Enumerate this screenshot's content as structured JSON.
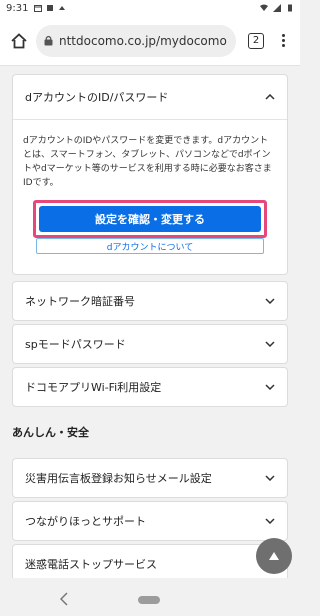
{
  "status_bar": {
    "time": "9:31",
    "icons": [
      "calendar-icon",
      "kanji-notification-icon",
      "cloud-icon",
      "wifi-icon",
      "signal-icon",
      "battery-icon"
    ]
  },
  "browser": {
    "url": "nttdocomo.co.jp/mydocomo",
    "tab_count": "2"
  },
  "accordion_open": {
    "title": "dアカウントのID/パスワード",
    "description": "dアカウントのIDやパスワードを変更できます。dアカウントとは、スマートフォン、タブレット、パソコンなどでdポイントやdマーケット等のサービスを利用する時に必要なお客さまIDです。",
    "primary_button": "設定を確認・変更する",
    "secondary_button": "dアカウントについて"
  },
  "accordion_items": [
    {
      "label": "ネットワーク暗証番号"
    },
    {
      "label": "spモードパスワード"
    },
    {
      "label": "ドコモアプリWi-Fi利用設定"
    }
  ],
  "section": {
    "title": "あんしん・安全"
  },
  "safety_items": [
    {
      "label": "災害用伝言板登録お知らせメール設定"
    },
    {
      "label": "つながりほっとサポート"
    },
    {
      "label": "迷惑電話ストップサービス"
    }
  ],
  "colors": {
    "primary_button": "#0a6fe6",
    "highlight_border": "#e6487a",
    "background": "#f1f1f1"
  }
}
